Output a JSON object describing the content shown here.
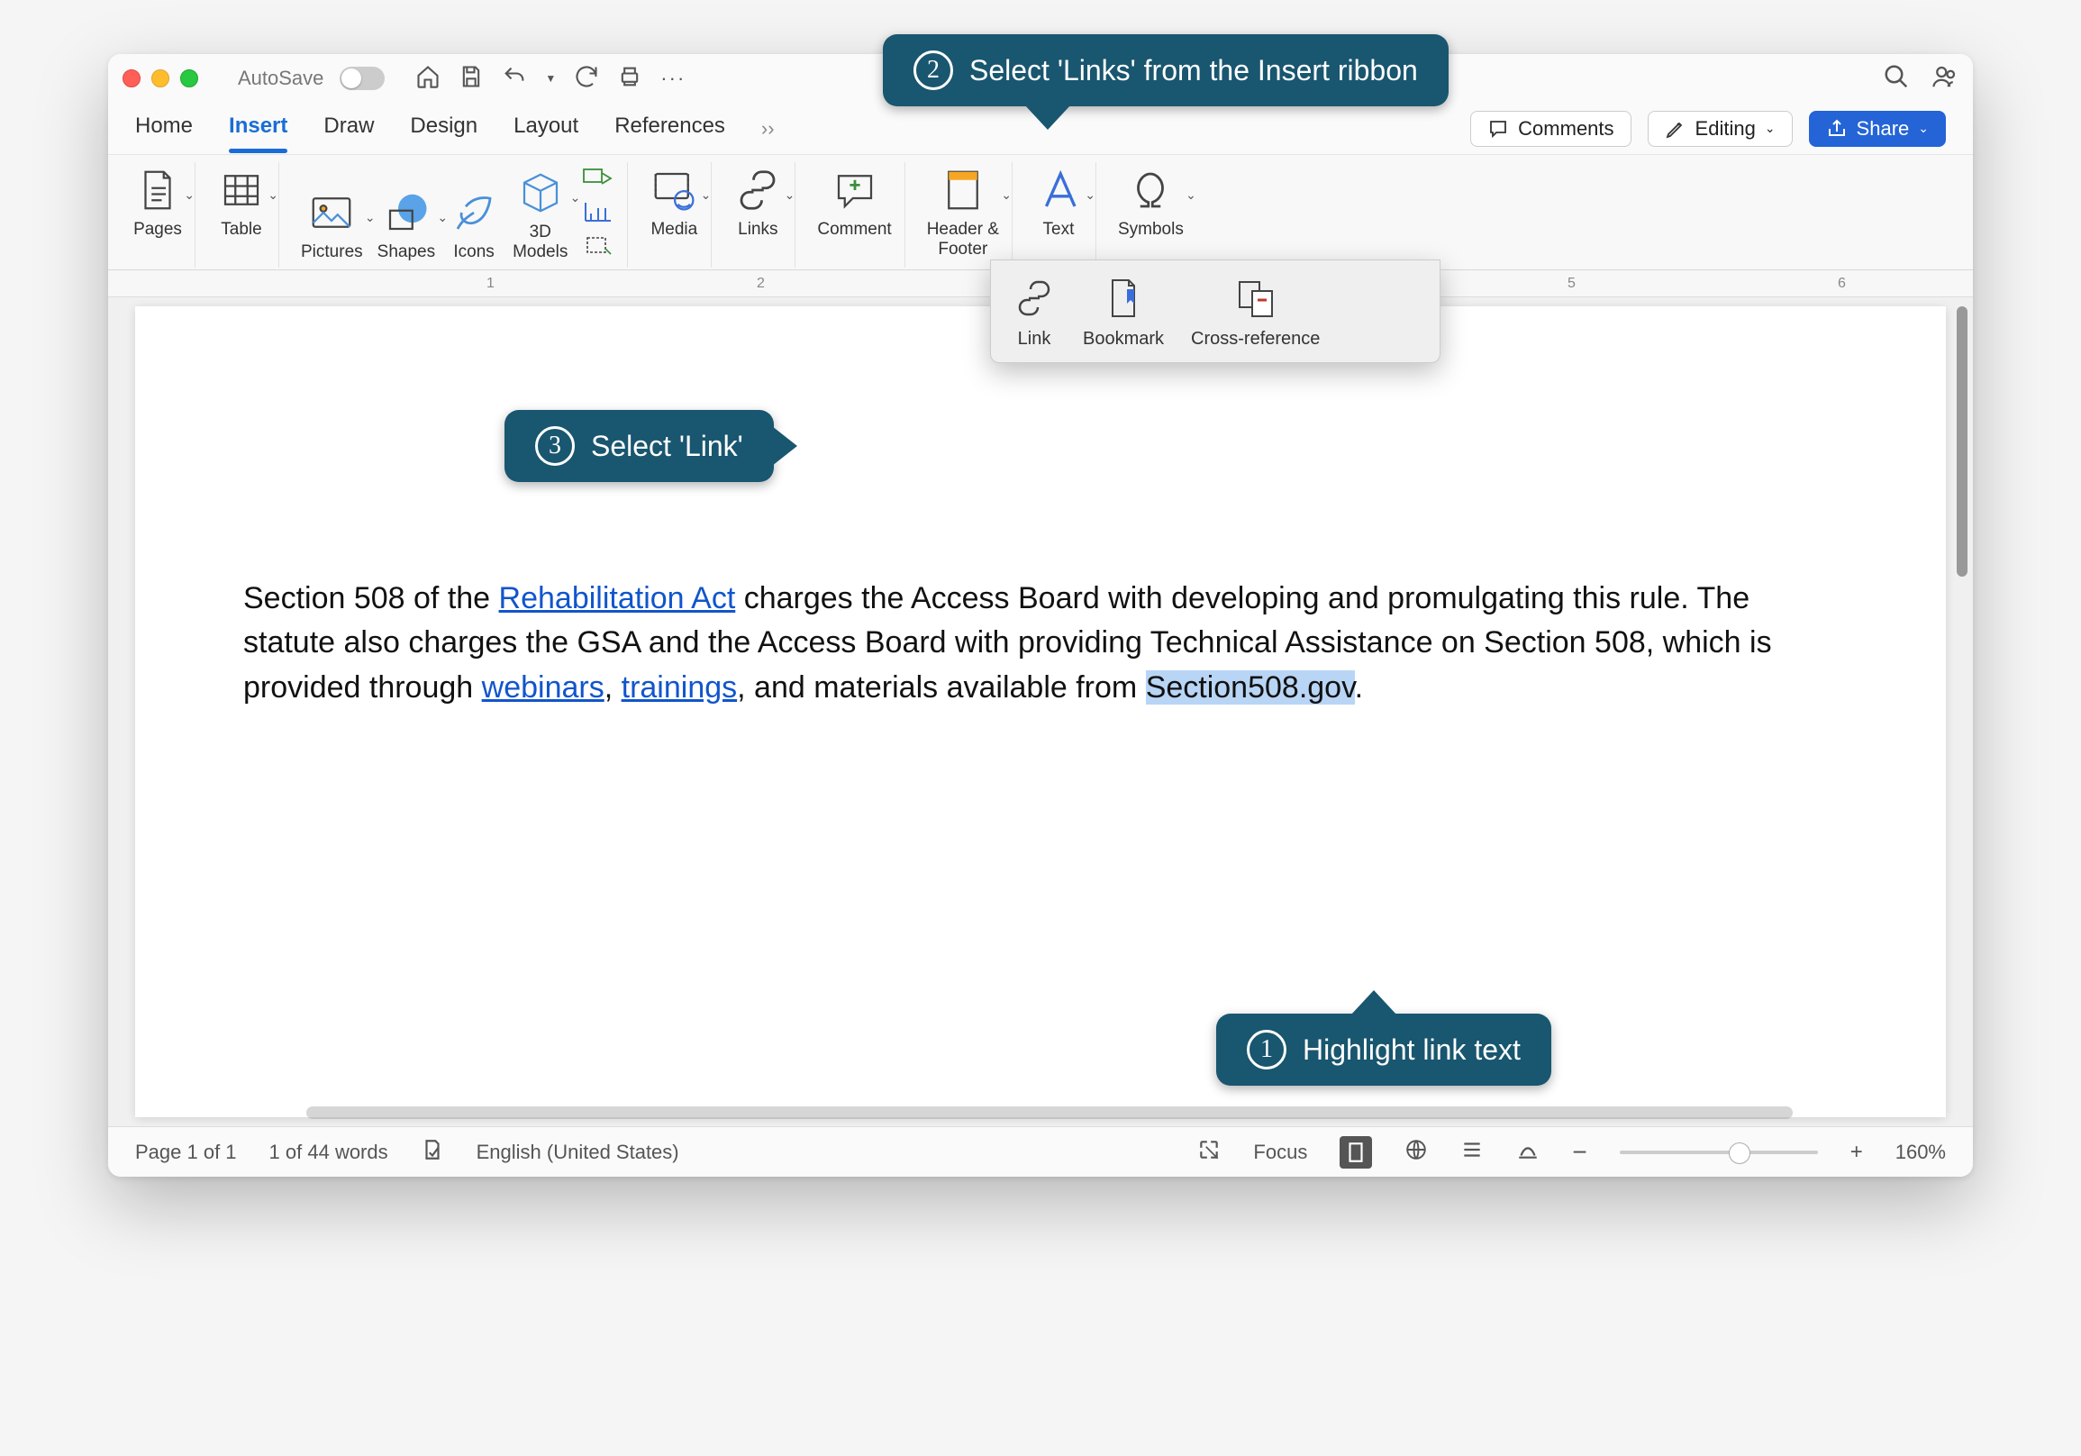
{
  "titlebar": {
    "autosave_label": "AutoSave"
  },
  "tabs": {
    "home": "Home",
    "insert": "Insert",
    "draw": "Draw",
    "design": "Design",
    "layout": "Layout",
    "references": "References"
  },
  "tab_actions": {
    "comments": "Comments",
    "editing": "Editing",
    "share": "Share"
  },
  "ribbon": {
    "pages": "Pages",
    "table": "Table",
    "pictures": "Pictures",
    "shapes": "Shapes",
    "icons": "Icons",
    "models": "3D\nModels",
    "media": "Media",
    "links": "Links",
    "comment": "Comment",
    "header_footer": "Header &\nFooter",
    "text": "Text",
    "symbols": "Symbols"
  },
  "links_dropdown": {
    "link": "Link",
    "bookmark": "Bookmark",
    "cross_reference": "Cross-reference"
  },
  "ruler": {
    "n1": "1",
    "n2": "2",
    "n5": "5",
    "n6": "6"
  },
  "document": {
    "part1": "Section 508 of the ",
    "link1": "Rehabilitation Act",
    "part2": " charges the Access Board with developing and promulgating this rule.  The statute also charges the GSA and the Access Board with providing Technical Assistance on Section 508, which is provided through ",
    "link2": "webinars",
    "sep1": ", ",
    "link3": "trainings",
    "part3": ", and materials available from ",
    "highlighted": "Section508.gov",
    "part4": "."
  },
  "status": {
    "page": "Page 1 of 1",
    "words": "1 of 44 words",
    "language": "English (United States)",
    "focus": "Focus",
    "zoom": "160%"
  },
  "callouts": {
    "c1": "Highlight link text",
    "c2": "Select 'Links' from the Insert ribbon",
    "c3": "Select 'Link'"
  }
}
